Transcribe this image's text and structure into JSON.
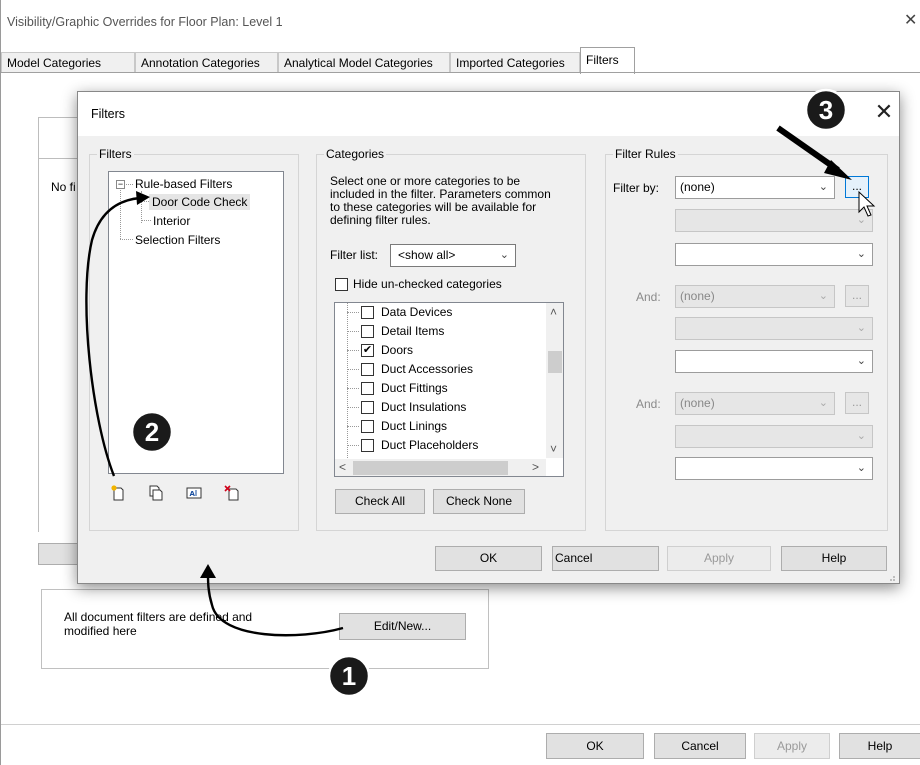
{
  "outer": {
    "title": "Visibility/Graphic Overrides for Floor Plan: Level 1",
    "close": "✕",
    "tabs": [
      "Model Categories",
      "Annotation Categories",
      "Analytical Model Categories",
      "Imported Categories",
      "Filters"
    ],
    "active_tab": "Filters",
    "no_filters_text": "No fi",
    "group_text": "All document filters are defined and modified here",
    "edit_button": "Edit/New...",
    "buttons": {
      "ok": "OK",
      "cancel": "Cancel",
      "apply": "Apply",
      "help": "Help"
    }
  },
  "dialog": {
    "title": "Filters",
    "close": "✕",
    "filters_group": "Filters",
    "tree": {
      "rule_based": "Rule-based Filters",
      "items": [
        "Door Code Check",
        "Interior"
      ],
      "selected": "Door Code Check",
      "selection_filters": "Selection Filters"
    },
    "categories_group": "Categories",
    "categories_desc": "Select one or more categories to be included in the filter.  Parameters common to these categories will be available for defining filter rules.",
    "filter_list_label": "Filter list:",
    "filter_list_value": "<show all>",
    "hide_unchecked": "Hide un-checked categories",
    "categories": [
      {
        "name": "Data Devices",
        "checked": false
      },
      {
        "name": "Detail Items",
        "checked": false
      },
      {
        "name": "Doors",
        "checked": true
      },
      {
        "name": "Duct Accessories",
        "checked": false
      },
      {
        "name": "Duct Fittings",
        "checked": false
      },
      {
        "name": "Duct Insulations",
        "checked": false
      },
      {
        "name": "Duct Linings",
        "checked": false
      },
      {
        "name": "Duct Placeholders",
        "checked": false
      }
    ],
    "check_all": "Check All",
    "check_none": "Check None",
    "rules_group": "Filter Rules",
    "filter_by_label": "Filter by:",
    "filter_by_value": "(none)",
    "and_label": "And:",
    "and_value": "(none)",
    "dots": "...",
    "buttons": {
      "ok": "OK",
      "cancel": "Cancel",
      "apply": "Apply",
      "help": "Help"
    }
  },
  "badges": [
    "1",
    "2",
    "3"
  ],
  "icons": [
    "new-filter-icon",
    "duplicate-filter-icon",
    "rename-filter-icon",
    "delete-filter-icon",
    "mouse-cursor-icon"
  ]
}
